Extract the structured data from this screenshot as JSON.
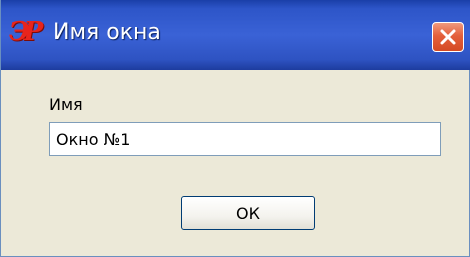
{
  "window": {
    "title": "Имя окна",
    "logo_text": "ЭР",
    "logo_color": "#e8241c",
    "title_bar_color": "#2d55c8",
    "close_button_color": "#e4603c",
    "close_icon": "close-icon"
  },
  "form": {
    "name_label": "Имя",
    "name_value": "Окно №1",
    "ok_label": "ОК"
  }
}
